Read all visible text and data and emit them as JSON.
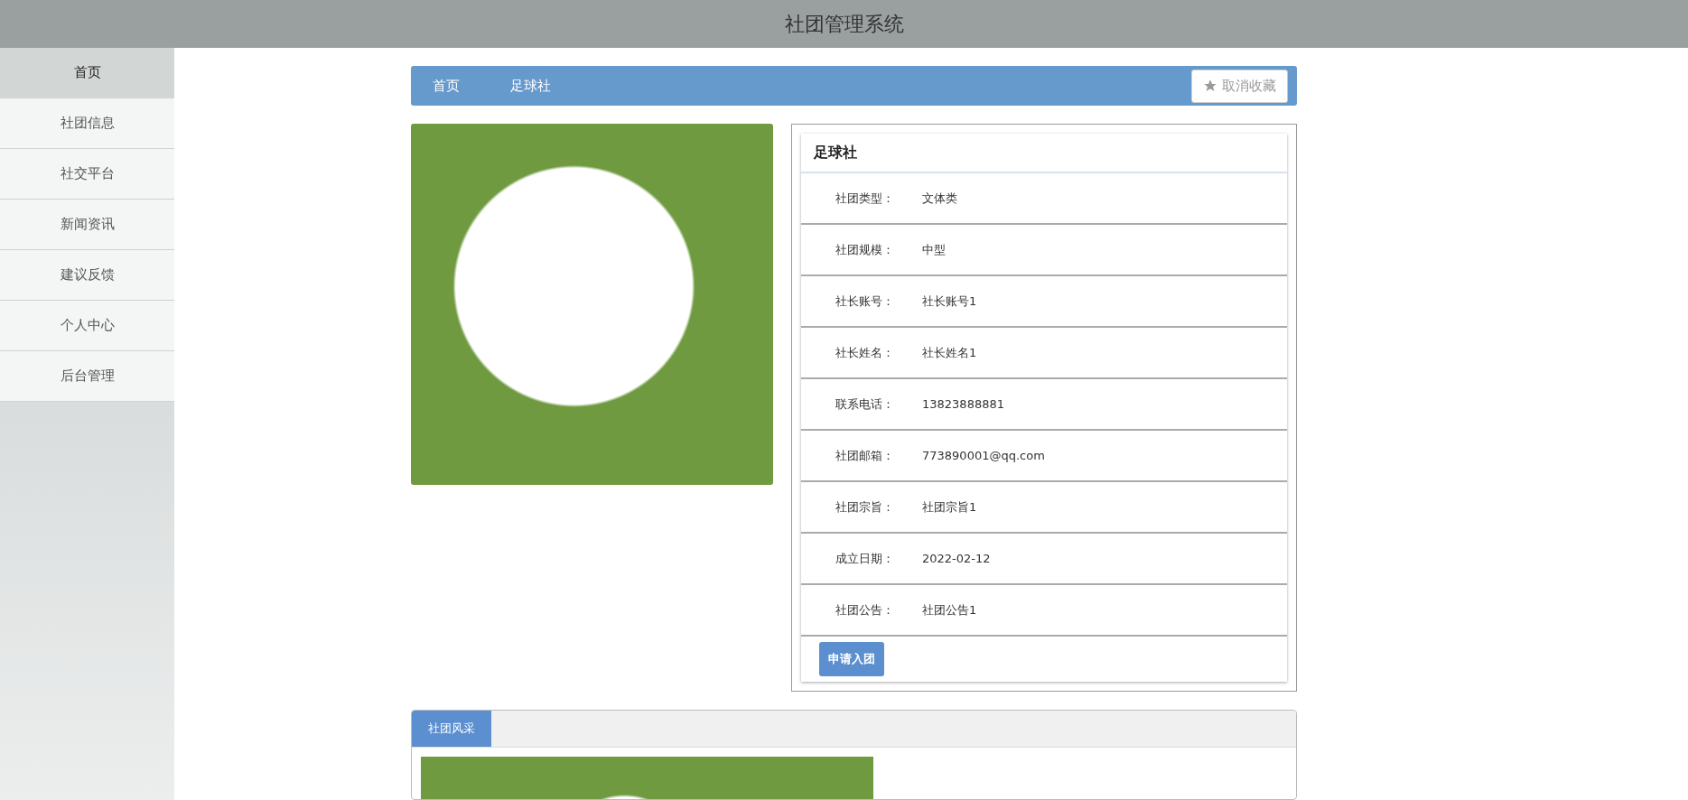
{
  "header": {
    "title": "社团管理系统"
  },
  "sidebar": {
    "items": [
      {
        "label": "首页",
        "selected": true
      },
      {
        "label": "社团信息",
        "selected": false
      },
      {
        "label": "社交平台",
        "selected": false
      },
      {
        "label": "新闻资讯",
        "selected": false
      },
      {
        "label": "建议反馈",
        "selected": false
      },
      {
        "label": "个人中心",
        "selected": false
      },
      {
        "label": "后台管理",
        "selected": false
      }
    ]
  },
  "breadcrumb": {
    "items": [
      "首页",
      "足球社"
    ],
    "favorite_button": "取消收藏"
  },
  "detail": {
    "title": "足球社",
    "rows": [
      {
        "label": "社团类型：",
        "value": "文体类"
      },
      {
        "label": "社团规模：",
        "value": "中型"
      },
      {
        "label": "社长账号：",
        "value": "社长账号1"
      },
      {
        "label": "社长姓名：",
        "value": "社长姓名1"
      },
      {
        "label": "联系电话：",
        "value": "13823888881"
      },
      {
        "label": "社团邮箱：",
        "value": "773890001@qq.com"
      },
      {
        "label": "社团宗旨：",
        "value": "社团宗旨1"
      },
      {
        "label": "成立日期：",
        "value": "2022-02-12"
      },
      {
        "label": "社团公告：",
        "value": "社团公告1"
      }
    ],
    "apply_button": "申请入团"
  },
  "tabs": [
    {
      "label": "社团风采",
      "selected": true
    }
  ]
}
